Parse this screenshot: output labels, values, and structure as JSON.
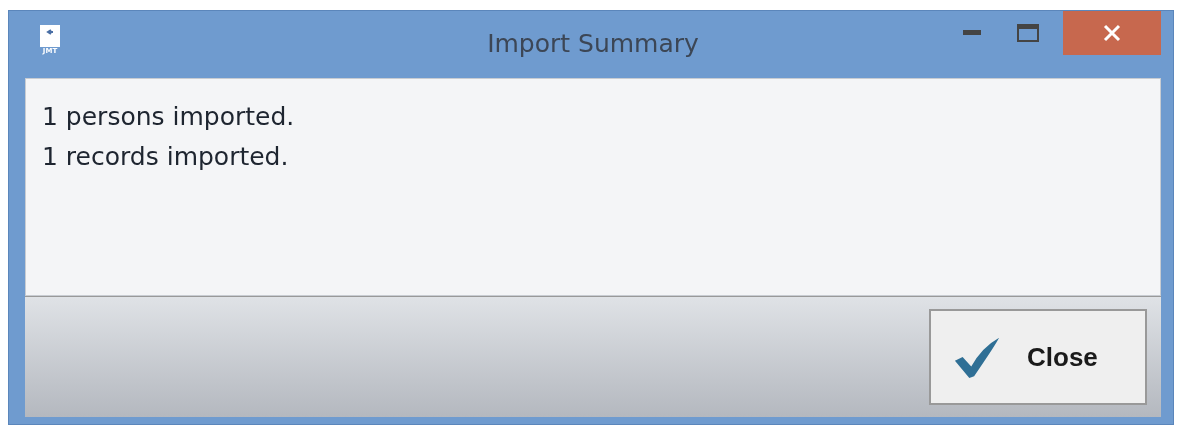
{
  "window": {
    "title": "Import Summary",
    "icon_label": "JMT"
  },
  "messages": [
    "1 persons imported.",
    "1 records imported."
  ],
  "buttons": [
    {
      "label": "Close",
      "kind": "confirm"
    }
  ]
}
